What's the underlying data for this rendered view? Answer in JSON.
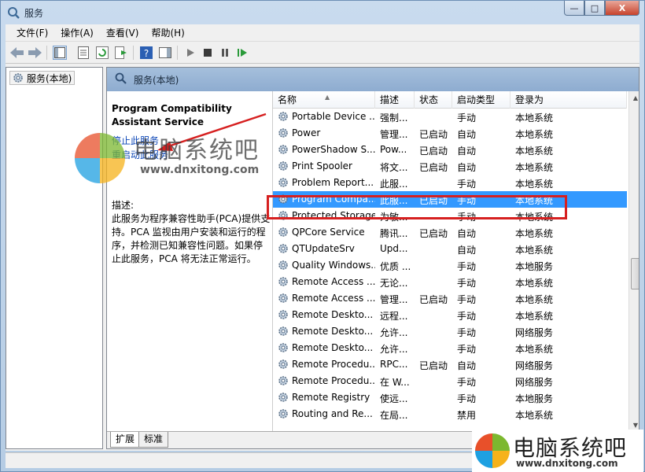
{
  "window": {
    "title": "服务",
    "buttons": {
      "minimize": "—",
      "maximize": "□",
      "close": "X"
    }
  },
  "menu": [
    "文件(F)",
    "操作(A)",
    "查看(V)",
    "帮助(H)"
  ],
  "tree": {
    "item": "服务(本地)"
  },
  "pane": {
    "header": "服务(本地)"
  },
  "detail": {
    "service_title": "Program Compatibility Assistant Service",
    "stop_link": "停止此服务",
    "restart_link": "重启动此服务",
    "desc_label": "描述:",
    "desc_text": "此服务为程序兼容性助手(PCA)提供支持。PCA 监视由用户安装和运行的程序，并检测已知兼容性问题。如果停止此服务，PCA 将无法正常运行。"
  },
  "columns": [
    "名称",
    "描述",
    "状态",
    "启动类型",
    "登录为"
  ],
  "rows": [
    {
      "name": "Portable Device ...",
      "desc": "强制...",
      "status": "",
      "startup": "手动",
      "logon": "本地系统"
    },
    {
      "name": "Power",
      "desc": "管理...",
      "status": "已启动",
      "startup": "自动",
      "logon": "本地系统"
    },
    {
      "name": "PowerShadow S...",
      "desc": "Pow...",
      "status": "已启动",
      "startup": "自动",
      "logon": "本地系统"
    },
    {
      "name": "Print Spooler",
      "desc": "将文...",
      "status": "已启动",
      "startup": "自动",
      "logon": "本地系统"
    },
    {
      "name": "Problem Report...",
      "desc": "此服...",
      "status": "",
      "startup": "手动",
      "logon": "本地系统"
    },
    {
      "name": "Program Compa...",
      "desc": "此服...",
      "status": "已启动",
      "startup": "手动",
      "logon": "本地系统",
      "selected": true
    },
    {
      "name": "Protected Storage",
      "desc": "为敏...",
      "status": "",
      "startup": "手动",
      "logon": "本地系统"
    },
    {
      "name": "QPCore Service",
      "desc": "腾讯...",
      "status": "已启动",
      "startup": "自动",
      "logon": "本地系统"
    },
    {
      "name": "QTUpdateSrv",
      "desc": "Upd...",
      "status": "",
      "startup": "自动",
      "logon": "本地系统"
    },
    {
      "name": "Quality Windows...",
      "desc": "优质 ...",
      "status": "",
      "startup": "手动",
      "logon": "本地服务"
    },
    {
      "name": "Remote Access ...",
      "desc": "无论...",
      "status": "",
      "startup": "手动",
      "logon": "本地系统"
    },
    {
      "name": "Remote Access ...",
      "desc": "管理...",
      "status": "已启动",
      "startup": "手动",
      "logon": "本地系统"
    },
    {
      "name": "Remote Deskto...",
      "desc": "远程...",
      "status": "",
      "startup": "手动",
      "logon": "本地系统"
    },
    {
      "name": "Remote Deskto...",
      "desc": "允许...",
      "status": "",
      "startup": "手动",
      "logon": "网络服务"
    },
    {
      "name": "Remote Deskto...",
      "desc": "允许...",
      "status": "",
      "startup": "手动",
      "logon": "本地系统"
    },
    {
      "name": "Remote Procedu...",
      "desc": "RPC...",
      "status": "已启动",
      "startup": "自动",
      "logon": "网络服务"
    },
    {
      "name": "Remote Procedu...",
      "desc": "在 W...",
      "status": "",
      "startup": "手动",
      "logon": "网络服务"
    },
    {
      "name": "Remote Registry",
      "desc": "使远...",
      "status": "",
      "startup": "手动",
      "logon": "本地服务"
    },
    {
      "name": "Routing and Re...",
      "desc": "在局...",
      "status": "",
      "startup": "禁用",
      "logon": "本地系统"
    }
  ],
  "tabs": [
    "扩展",
    "标准"
  ],
  "watermark": {
    "brand": "电脑系统吧",
    "url": "www.dnxitong.com"
  },
  "colors": {
    "selection": "#3399ff",
    "callout": "#d62020",
    "link": "#0d47b7"
  }
}
